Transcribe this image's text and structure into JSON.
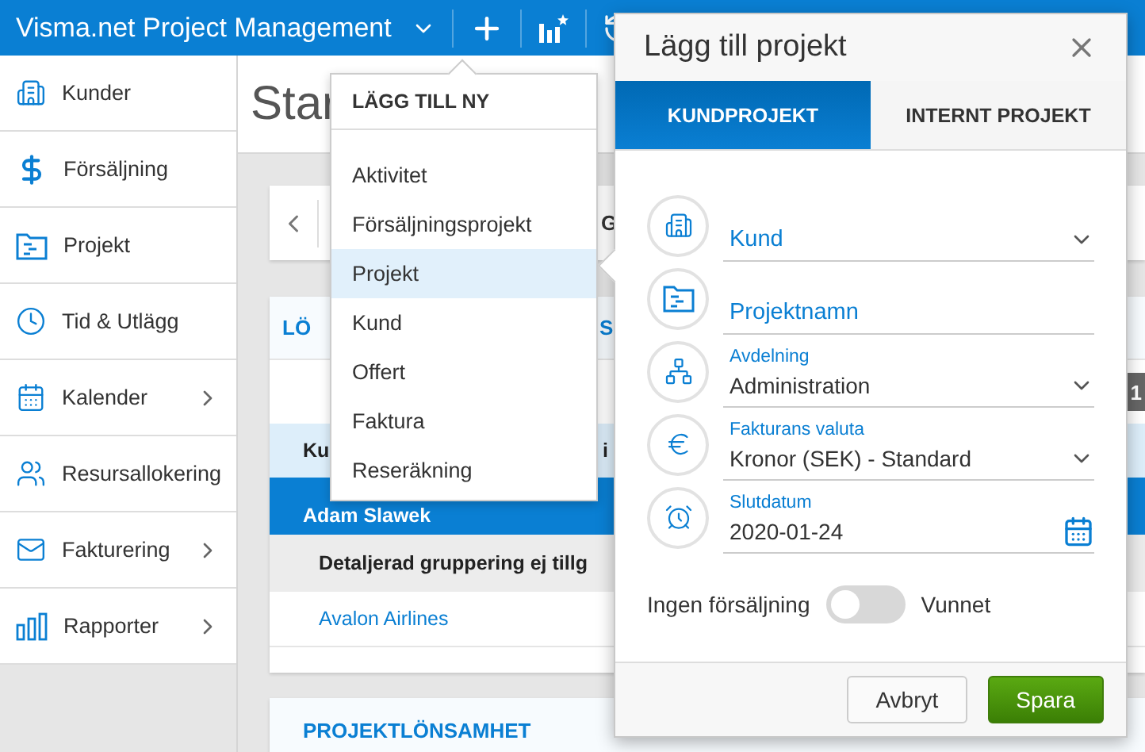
{
  "app_bar": {
    "title": "Visma.net Project Management"
  },
  "sidebar": {
    "items": [
      {
        "label": "Kunder",
        "has_submenu": false
      },
      {
        "label": "Försäljning",
        "has_submenu": false
      },
      {
        "label": "Projekt",
        "has_submenu": false
      },
      {
        "label": "Tid & Utlägg",
        "has_submenu": false
      },
      {
        "label": "Kalender",
        "has_submenu": true
      },
      {
        "label": "Resursallokering",
        "has_submenu": false
      },
      {
        "label": "Fakturering",
        "has_submenu": true
      },
      {
        "label": "Rapporter",
        "has_submenu": true
      }
    ]
  },
  "page": {
    "title": "Star",
    "toolbar_text": "G",
    "card": {
      "tab_1": "LÖ",
      "tab_2": "S",
      "badge": "1",
      "table": {
        "columns": [
          "Ku",
          "i"
        ],
        "rows": [
          {
            "kind": "group",
            "cells": [
              "Adam Slawek"
            ]
          },
          {
            "kind": "subgroup",
            "cells": [
              "Detaljerad gruppering ej tillg"
            ]
          },
          {
            "kind": "link",
            "cells": [
              "Avalon Airlines"
            ]
          }
        ]
      }
    },
    "card_2": {
      "title": "PROJEKTLÖNSAMHET"
    }
  },
  "add_menu": {
    "title": "LÄGG TILL NY",
    "items": [
      {
        "label": "Aktivitet",
        "selected": false
      },
      {
        "label": "Försäljningsprojekt",
        "selected": false
      },
      {
        "label": "Projekt",
        "selected": true
      },
      {
        "label": "Kund",
        "selected": false
      },
      {
        "label": "Offert",
        "selected": false
      },
      {
        "label": "Faktura",
        "selected": false
      },
      {
        "label": "Reseräkning",
        "selected": false
      }
    ]
  },
  "dialog": {
    "title": "Lägg till projekt",
    "tabs": [
      {
        "label": "KUNDPROJEKT",
        "selected": true
      },
      {
        "label": "INTERNT PROJEKT",
        "selected": false
      }
    ],
    "fields": [
      {
        "kind": "select",
        "placeholder": "Kund"
      },
      {
        "kind": "text",
        "placeholder": "Projektnamn"
      },
      {
        "kind": "select",
        "label": "Avdelning",
        "value": "Administration"
      },
      {
        "kind": "select",
        "label": "Fakturans valuta",
        "value": "Kronor (SEK) - Standard"
      },
      {
        "kind": "date",
        "label": "Slutdatum",
        "value": "2020-01-24"
      }
    ],
    "toggle": {
      "label_off": "Ingen försäljning",
      "label_on": "Vunnet",
      "on": false
    },
    "buttons": [
      {
        "label": "Avbryt",
        "kind": "secondary"
      },
      {
        "label": "Spara",
        "kind": "primary"
      }
    ]
  }
}
